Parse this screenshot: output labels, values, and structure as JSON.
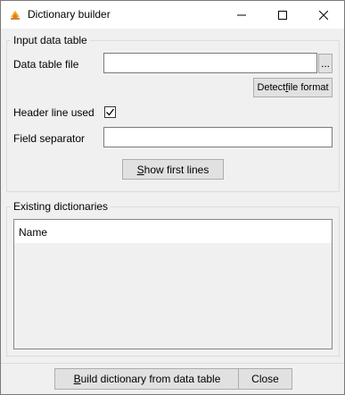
{
  "window": {
    "title": "Dictionary builder",
    "icon": "app-fire-icon"
  },
  "input_group": {
    "label": "Input data table",
    "data_table_file_label": "Data table file",
    "data_table_file_value": "",
    "browse_label": "...",
    "detect_label_pre": "Detect ",
    "detect_label_u": "f",
    "detect_label_post": "ile format",
    "header_label": "Header line used",
    "header_checked": true,
    "separator_label": "Field separator",
    "separator_value": "",
    "show_first_pre": "",
    "show_first_u": "S",
    "show_first_post": "how first lines"
  },
  "existing_group": {
    "label": "Existing dictionaries",
    "columns": [
      "Name"
    ]
  },
  "footer": {
    "build_pre": "",
    "build_u": "B",
    "build_post": "uild dictionary from data table",
    "close_label": "Close"
  }
}
